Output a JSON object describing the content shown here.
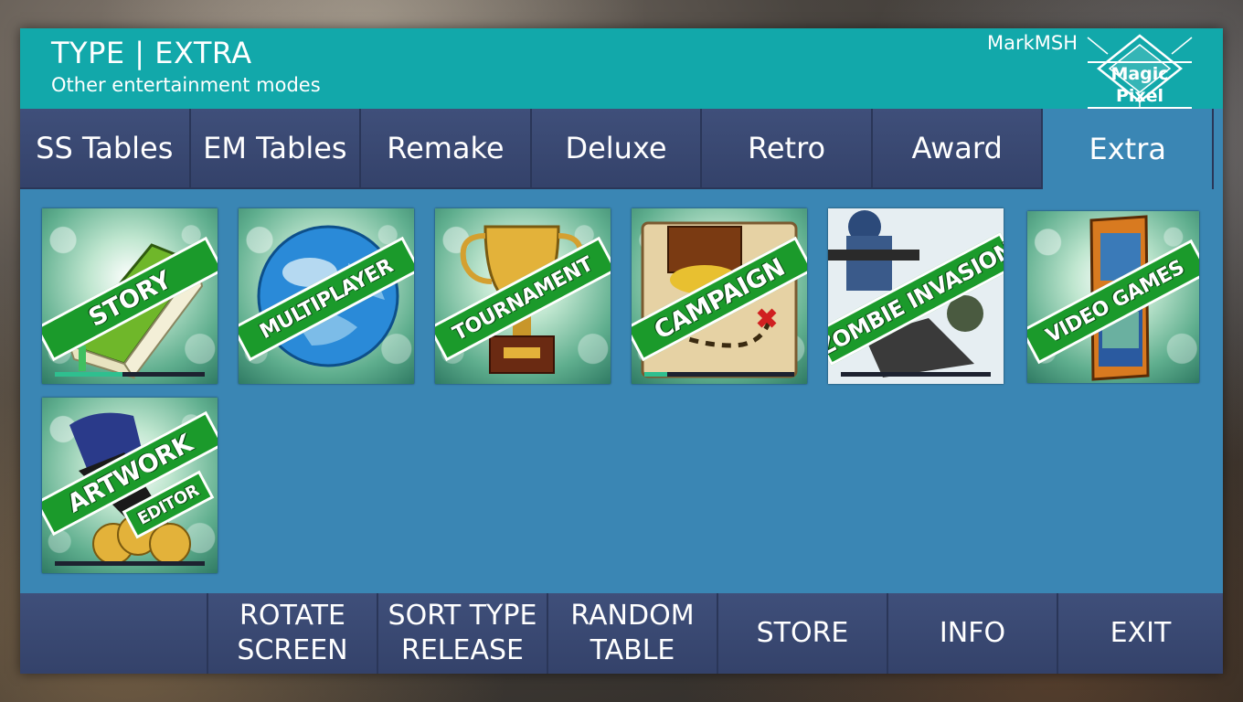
{
  "header": {
    "title": "TYPE | EXTRA",
    "subtitle": "Other entertainment modes",
    "username": "MarkMSH",
    "logo_text": "Magic Pixel"
  },
  "tabs": [
    {
      "label": "SS Tables",
      "active": false
    },
    {
      "label": "EM Tables",
      "active": false
    },
    {
      "label": "Remake",
      "active": false
    },
    {
      "label": "Deluxe",
      "active": false
    },
    {
      "label": "Retro",
      "active": false
    },
    {
      "label": "Award",
      "active": false
    },
    {
      "label": "Extra",
      "active": true
    }
  ],
  "tiles": [
    {
      "label": "STORY",
      "icon": "book-icon",
      "progress": 0.45
    },
    {
      "label": "MULTIPLAYER",
      "icon": "globe-icon"
    },
    {
      "label": "TOURNAMENT",
      "icon": "trophy-icon"
    },
    {
      "label": "CAMPAIGN",
      "icon": "treasure-map-icon",
      "progress": 0.15
    },
    {
      "label": "ZOMBIE INVASION",
      "icon": "soldier-icon",
      "progress": 0.0
    },
    {
      "label": "VIDEO GAMES",
      "icon": "arcade-cabinet-icon"
    },
    {
      "label": "ARTWORK",
      "sublabel": "EDITOR",
      "icon": "paint-brush-coins-icon",
      "progress": 0.0
    }
  ],
  "footer": {
    "rotate": [
      "ROTATE",
      "SCREEN"
    ],
    "sort": [
      "SORT TYPE",
      "RELEASE"
    ],
    "random": [
      "RANDOM",
      "TABLE"
    ],
    "store": "STORE",
    "info": "INFO",
    "exit": "EXIT"
  },
  "colors": {
    "header": "#12a8aa",
    "panel": "#3a86b4",
    "tab": "#3f4f7a",
    "banner": "#1b9a2b"
  }
}
